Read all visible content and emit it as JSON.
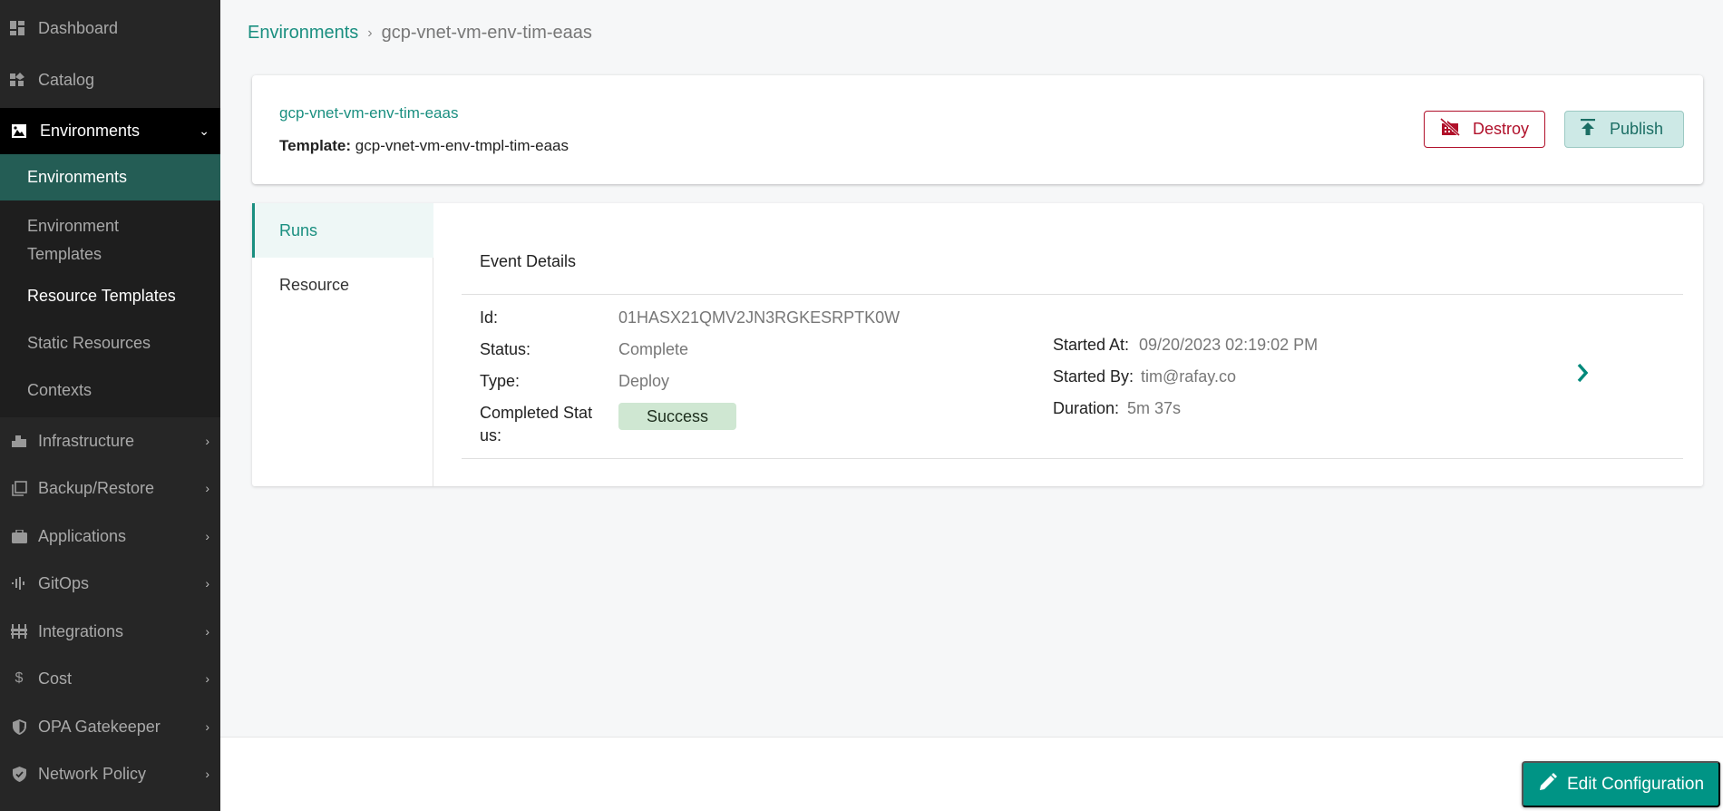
{
  "sidebar": {
    "top_items": [
      {
        "label": "Dashboard",
        "icon": "dashboard-icon"
      },
      {
        "label": "Catalog",
        "icon": "catalog-icon"
      }
    ],
    "environments_section": {
      "label": "Environments",
      "icon": "environments-icon",
      "expanded": true,
      "children": [
        {
          "label": "Environments",
          "active": true
        },
        {
          "label": "Environment Templates"
        },
        {
          "label": "Resource Templates"
        },
        {
          "label": "Static Resources"
        },
        {
          "label": "Contexts"
        }
      ]
    },
    "bottom_items": [
      {
        "label": "Infrastructure",
        "icon": "infrastructure-icon"
      },
      {
        "label": "Backup/Restore",
        "icon": "backup-icon"
      },
      {
        "label": "Applications",
        "icon": "applications-icon"
      },
      {
        "label": "GitOps",
        "icon": "gitops-icon"
      },
      {
        "label": "Integrations",
        "icon": "integrations-icon"
      },
      {
        "label": "Cost",
        "icon": "dollar-icon"
      },
      {
        "label": "OPA Gatekeeper",
        "icon": "shield-icon"
      },
      {
        "label": "Network Policy",
        "icon": "shield-check-icon"
      }
    ]
  },
  "breadcrumb": {
    "parent": "Environments",
    "separator": "›",
    "current": "gcp-vnet-vm-env-tim-eaas"
  },
  "header": {
    "env_name": "gcp-vnet-vm-env-tim-eaas",
    "template_label": "Template:",
    "template_value": "gcp-vnet-vm-env-tmpl-tim-eaas",
    "destroy_label": "Destroy",
    "publish_label": "Publish"
  },
  "tabs": [
    {
      "label": "Runs",
      "active": true
    },
    {
      "label": "Resource"
    }
  ],
  "event": {
    "title": "Event Details",
    "id_label": "Id:",
    "id_value": "01HASX21QMV2JN3RGKESRPTK0W",
    "status_label": "Status:",
    "status_value": "Complete",
    "type_label": "Type:",
    "type_value": "Deploy",
    "completed_label_1": "Completed Stat",
    "completed_label_2": "us:",
    "completed_value": "Success",
    "started_at_label": "Started At:",
    "started_at_value": "09/20/2023 02:19:02 PM",
    "started_by_label": "Started By:",
    "started_by_value": "tim@rafay.co",
    "duration_label": "Duration:",
    "duration_value": "5m 37s"
  },
  "footer": {
    "edit_label": "Edit Configuration"
  },
  "colors": {
    "accent": "#009485",
    "danger": "#b0102a",
    "sidebar_bg": "#262626",
    "sidebar_active": "#245d55",
    "success_badge": "#cfe7d2"
  }
}
